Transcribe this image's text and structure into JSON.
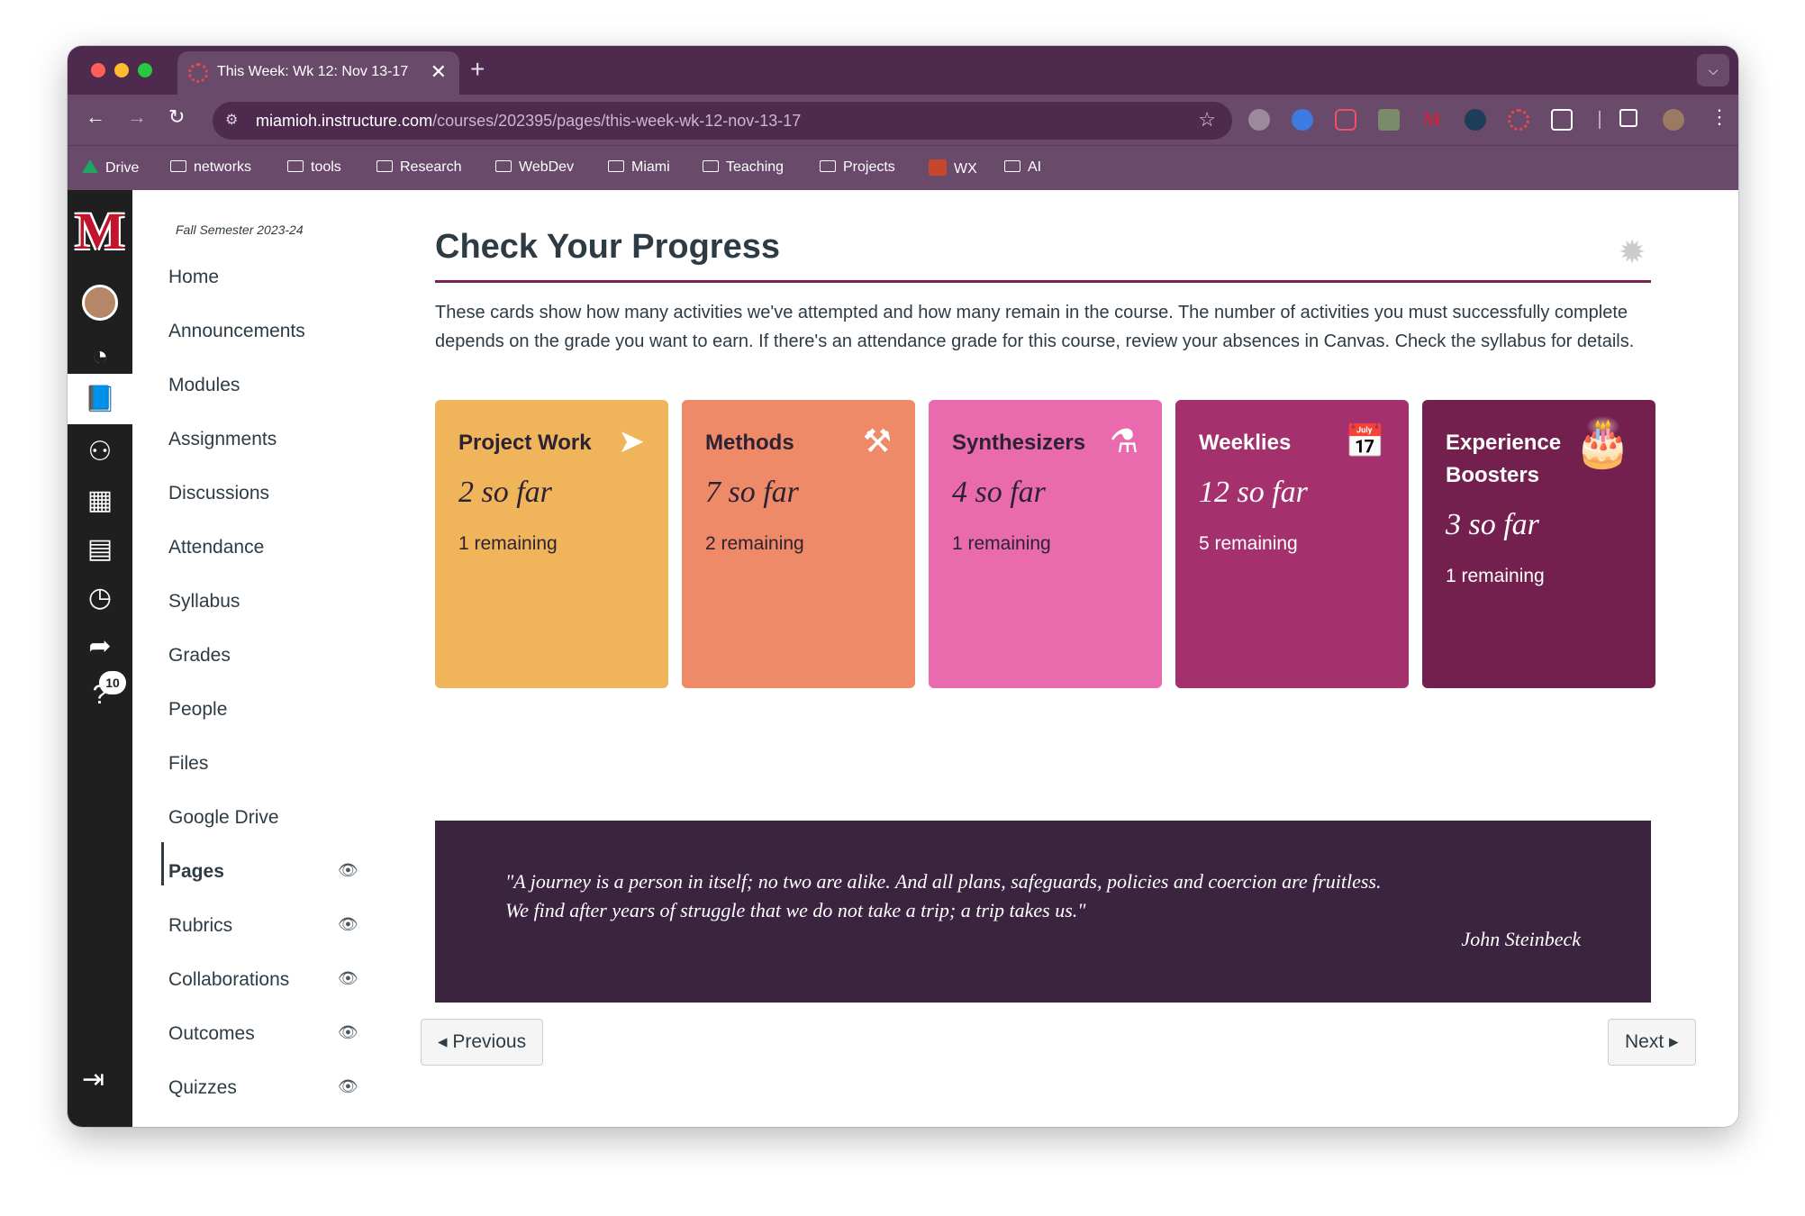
{
  "browser": {
    "tab_title": "This Week: Wk 12: Nov 13-17",
    "close_glyph": "✕",
    "new_tab_glyph": "+",
    "url_host": "miamioh.instructure.com",
    "url_path": "/courses/202395/pages/this-week-wk-12-nov-13-17",
    "bookmarks": [
      {
        "label": "Drive",
        "icon": "google-drive-icon"
      },
      {
        "label": "networks",
        "icon": "folder-icon"
      },
      {
        "label": "tools",
        "icon": "folder-icon"
      },
      {
        "label": "Research",
        "icon": "folder-icon"
      },
      {
        "label": "WebDev",
        "icon": "folder-icon"
      },
      {
        "label": "Miami",
        "icon": "folder-icon"
      },
      {
        "label": "Teaching",
        "icon": "folder-icon"
      },
      {
        "label": "Projects",
        "icon": "folder-icon"
      },
      {
        "label": "WX",
        "icon": "wx-icon"
      },
      {
        "label": "AI",
        "icon": "folder-icon"
      }
    ]
  },
  "global_nav": {
    "logo": "M",
    "badge_count": "10"
  },
  "course_nav": {
    "semester": "Fall Semester 2023-24",
    "items": [
      {
        "label": "Home"
      },
      {
        "label": "Announcements"
      },
      {
        "label": "Modules"
      },
      {
        "label": "Assignments"
      },
      {
        "label": "Discussions"
      },
      {
        "label": "Attendance"
      },
      {
        "label": "Syllabus"
      },
      {
        "label": "Grades"
      },
      {
        "label": "People"
      },
      {
        "label": "Files"
      },
      {
        "label": "Google Drive"
      },
      {
        "label": "Pages"
      },
      {
        "label": "Rubrics"
      },
      {
        "label": "Collaborations"
      },
      {
        "label": "Outcomes"
      },
      {
        "label": "Quizzes"
      }
    ],
    "active": "Pages"
  },
  "page": {
    "title": "Check Your Progress",
    "intro": "These cards show how many activities we've attempted and how many remain in the course. The number of activities you must successfully complete depends on the grade you want to earn. If there's an attendance grade for this course, review your absences in Canvas. Check the syllabus for details.",
    "cards": [
      {
        "title": "Project Work",
        "so_far": "2 so far",
        "remaining": "1 remaining",
        "icon": "paper-plane-icon",
        "color": "#f0b45a"
      },
      {
        "title": "Methods",
        "so_far": "7 so far",
        "remaining": "2 remaining",
        "icon": "tools-icon",
        "color": "#ef8a68"
      },
      {
        "title": "Synthesizers",
        "so_far": "4 so far",
        "remaining": "1 remaining",
        "icon": "flask-icon",
        "color": "#e96aad"
      },
      {
        "title": "Weeklies",
        "so_far": "12 so far",
        "remaining": "5 remaining",
        "icon": "calendar-icon",
        "color": "#a5306e"
      },
      {
        "title": "Experience Boosters",
        "so_far": "3 so far",
        "remaining": "1 remaining",
        "icon": "birthday-cake-icon",
        "color": "#74204f"
      }
    ],
    "quote": {
      "line1": "\"A journey is a person in itself; no two are alike. And all plans, safeguards, policies and coercion are fruitless.",
      "line2": "We find after years of struggle that we do not take a trip; a trip takes us.\"",
      "author": "John Steinbeck"
    },
    "prev_label": "◂ Previous",
    "next_label": "Next ▸"
  }
}
